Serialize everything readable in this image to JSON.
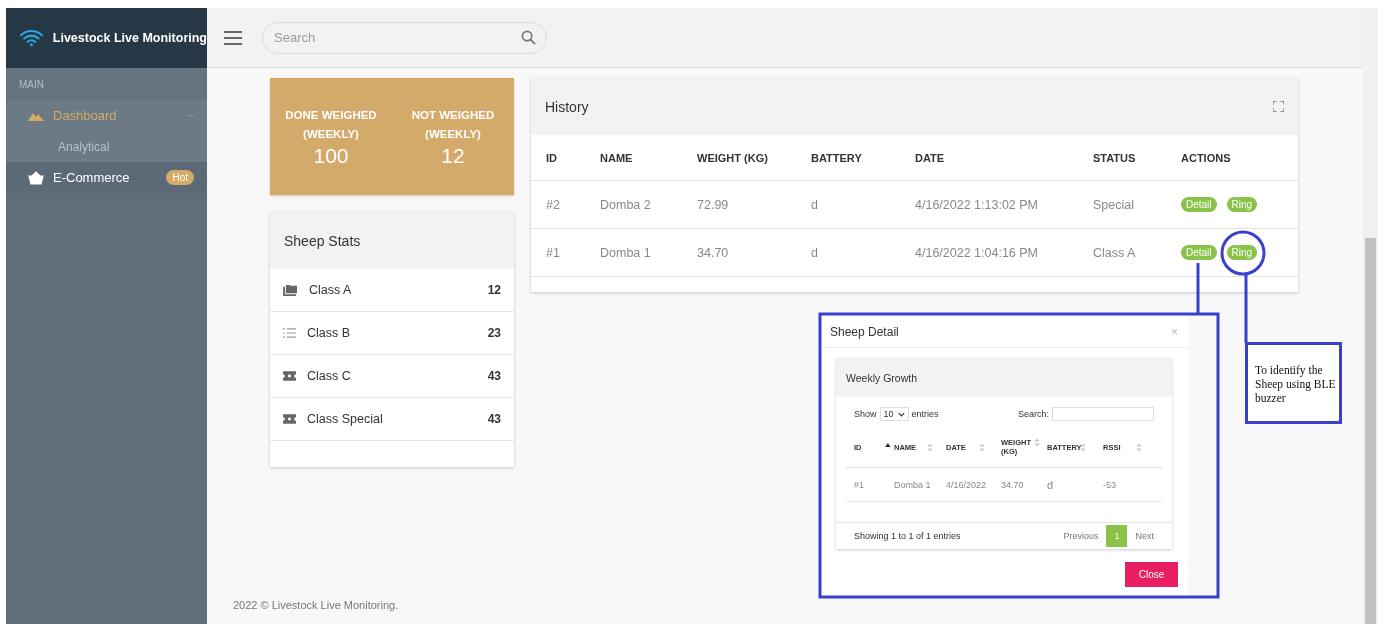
{
  "sidebar": {
    "brand": "Livestock Live Monitoring",
    "section": "MAIN",
    "items": [
      {
        "kind": "mountain",
        "label": "Dashboard",
        "selected": true,
        "expanded": true,
        "children": [
          {
            "label": "Analytical"
          }
        ]
      },
      {
        "kind": "basket",
        "label": "E-Commerce",
        "selected": false,
        "badge": "Hot"
      }
    ]
  },
  "search": {
    "placeholder": "Search"
  },
  "weigh_card": [
    {
      "label": "DONE WEIGHED (WEEKLY)",
      "value": "100"
    },
    {
      "label": "NOT WEIGHED (WEEKLY)",
      "value": "12"
    }
  ],
  "sheep_stats": {
    "title": "Sheep Stats",
    "rows": [
      {
        "kind": "photos",
        "label": "Class A",
        "count": "12"
      },
      {
        "kind": "list",
        "label": "Class B",
        "count": "23"
      },
      {
        "kind": "ticket",
        "label": "Class C",
        "count": "43"
      },
      {
        "kind": "ticket",
        "label": "Class Special",
        "count": "43"
      }
    ]
  },
  "history": {
    "title": "History",
    "columns": [
      "ID",
      "NAME",
      "WEIGHT (KG)",
      "BATTERY",
      "DATE",
      "STATUS",
      "ACTIONS"
    ],
    "rows": [
      {
        "cells": [
          "#2",
          "Domba 2",
          "72.99",
          "d",
          "4/16/2022 1:13:02 PM",
          "Special"
        ],
        "actions": [
          "Detail",
          "Ring"
        ]
      },
      {
        "cells": [
          "#1",
          "Domba 1",
          "34.70",
          "d",
          "4/16/2022 1:04:16 PM",
          "Class A"
        ],
        "actions": [
          "Detail",
          "Ring"
        ]
      }
    ]
  },
  "modal": {
    "title": "Sheep Detail",
    "close_icon": "×",
    "panel_title": "Weekly Growth",
    "show_label": "Show",
    "page_size": "10",
    "entries_label": "entries",
    "search_label": "Search:",
    "columns": [
      {
        "label": "ID",
        "sorted": true
      },
      {
        "label": "NAME",
        "sorted": false
      },
      {
        "label": "DATE",
        "sorted": false
      },
      {
        "label": "WEIGHT (KG)",
        "sorted": false
      },
      {
        "label": "BATTERY",
        "sorted": false
      },
      {
        "label": "RSSI",
        "sorted": false
      }
    ],
    "rows": [
      [
        "#1",
        "Domba 1",
        "4/16/2022",
        "34.70",
        "d",
        "-53"
      ]
    ],
    "info": "Showing 1 to 1 of 1 entries",
    "previous": "Previous",
    "pages": [
      {
        "label": "1",
        "selected": true
      }
    ],
    "next": "Next",
    "close_button": "Close"
  },
  "annotation": {
    "callout": "To identify the Sheep using BLE buzzer"
  },
  "footer": "2022 © Livestock Live Monitoring."
}
